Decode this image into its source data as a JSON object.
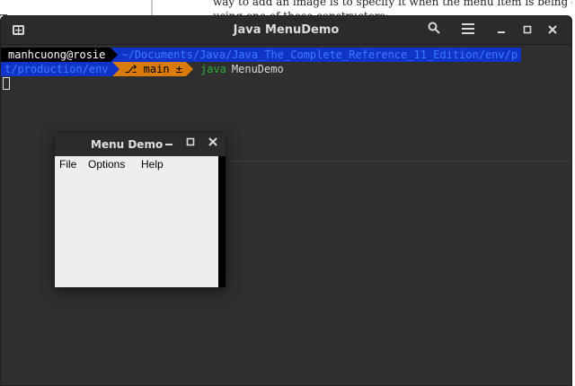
{
  "background_doc": {
    "lines": [
      "way to add an image is to specify it when the menu item is being constructed",
      "using one of these constructors:"
    ],
    "left_mark": "T"
  },
  "terminal": {
    "title": "Java MenuDemo",
    "prompt": {
      "user_host": "manhcuong@rosie",
      "path": "~/Documents/Java/Java_The_Complete_Reference_11_Edition/env/p",
      "path_cont": "t/production/env",
      "git_branch": "⎇ main ±",
      "command": "java",
      "argument": "MenuDemo"
    },
    "icons": {
      "new_tab": "new-tab-icon",
      "search": "search-icon",
      "menu": "hamburger-menu-icon",
      "minimize": "minimize-icon",
      "maximize": "maximize-icon",
      "close": "close-icon"
    }
  },
  "menu_demo": {
    "title": "Menu Demo",
    "menus": [
      "File",
      "Options",
      "Help"
    ]
  },
  "colors": {
    "terminal_bg": "#2f2f2f",
    "prompt_user_bg": "#000000",
    "prompt_path_bg": "#1034c8",
    "prompt_git_bg": "#d97a0a",
    "command_color": "#2fae3a"
  }
}
